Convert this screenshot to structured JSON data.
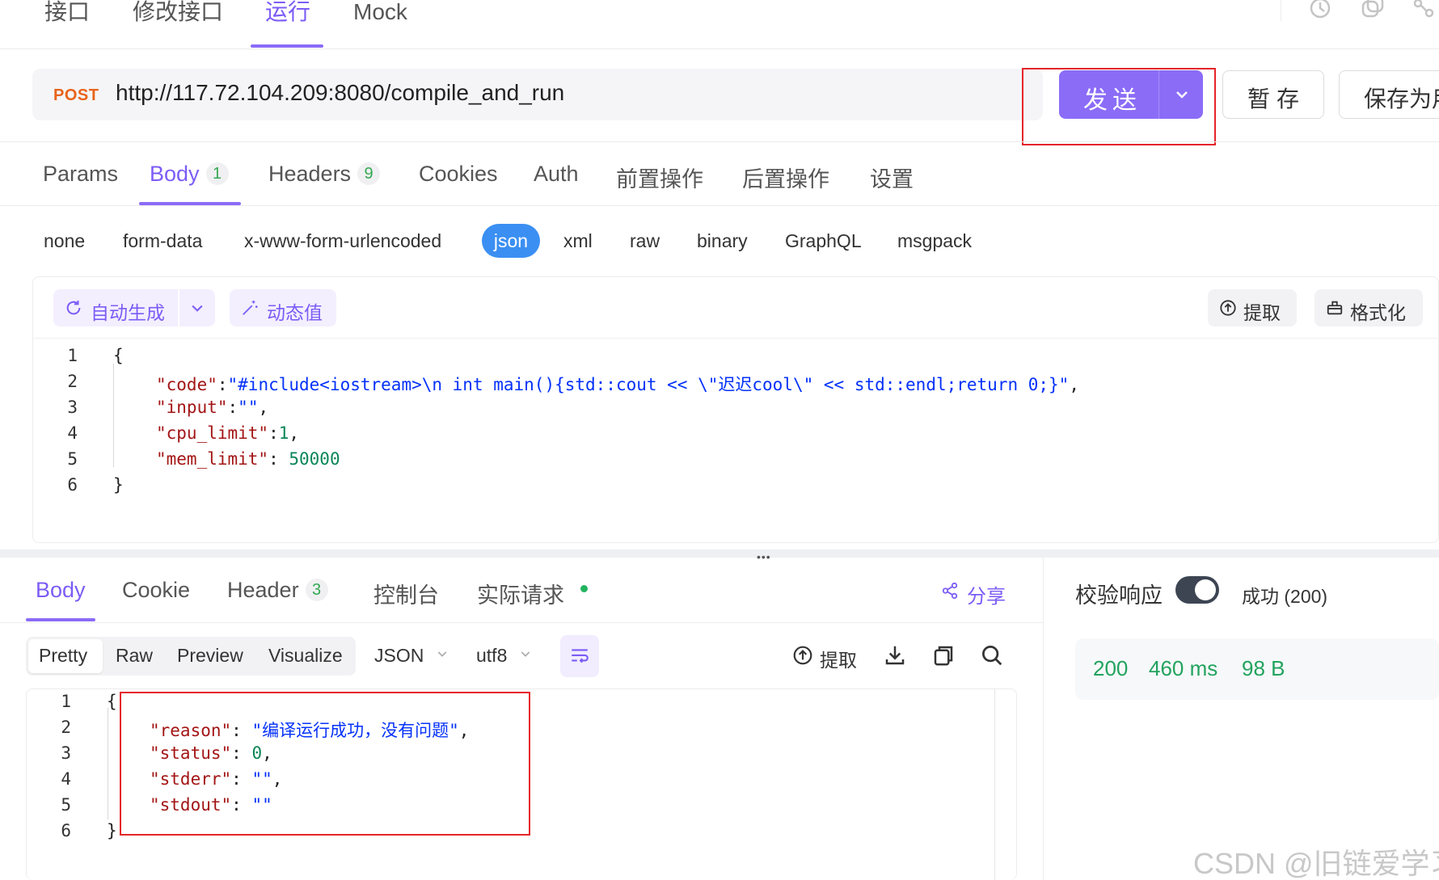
{
  "top_tabs": [
    {
      "label": "接口"
    },
    {
      "label": "修改接口"
    },
    {
      "label": "运行",
      "active": true
    },
    {
      "label": "Mock"
    }
  ],
  "request": {
    "method": "POST",
    "url": "http://117.72.104.209:8080/compile_and_run",
    "send_label": "发送",
    "save_temp_label": "暂存",
    "save_as_label": "保存为用例"
  },
  "request_tabs": [
    {
      "label": "Params"
    },
    {
      "label": "Body",
      "badge": "1",
      "active": true
    },
    {
      "label": "Headers",
      "badge": "9"
    },
    {
      "label": "Cookies"
    },
    {
      "label": "Auth"
    },
    {
      "label": "前置操作"
    },
    {
      "label": "后置操作"
    },
    {
      "label": "设置"
    }
  ],
  "body_types": [
    "none",
    "form-data",
    "x-www-form-urlencoded",
    "json",
    "xml",
    "raw",
    "binary",
    "GraphQL",
    "msgpack"
  ],
  "body_type_selected": "json",
  "editor_toolbar": {
    "auto_generate": "自动生成",
    "dynamic_value": "动态值",
    "extract": "提取",
    "format": "格式化"
  },
  "request_body_lines": [
    {
      "n": "1",
      "open": "{"
    },
    {
      "n": "2",
      "key": "\"code\"",
      "sep": ":",
      "value": "\"#include<iostream>\\n int main(){std::cout << \\\"迟迟cool\\\" << std::endl;return 0;}\"",
      "end": ","
    },
    {
      "n": "3",
      "key": "\"input\"",
      "sep": ":",
      "value": "\"\"",
      "end": ","
    },
    {
      "n": "4",
      "key": "\"cpu_limit\"",
      "sep": ":",
      "num": "1",
      "end": ","
    },
    {
      "n": "5",
      "key": "\"mem_limit\"",
      "sep": ": ",
      "num": "50000",
      "end": ""
    },
    {
      "n": "6",
      "close": "}"
    }
  ],
  "response_tabs": [
    {
      "label": "Body",
      "active": true
    },
    {
      "label": "Cookie"
    },
    {
      "label": "Header",
      "badge": "3"
    },
    {
      "label": "控制台"
    },
    {
      "label": "实际请求"
    }
  ],
  "share_label": "分享",
  "view_modes": [
    "Pretty",
    "Raw",
    "Preview",
    "Visualize"
  ],
  "format_select": "JSON",
  "encoding_select": "utf8",
  "response_extract_label": "提取",
  "response_body_lines": [
    {
      "n": "1",
      "open": "{"
    },
    {
      "n": "2",
      "key": "\"reason\"",
      "sep": ": ",
      "value": "\"编译运行成功，没有问题\"",
      "end": ","
    },
    {
      "n": "3",
      "key": "\"status\"",
      "sep": ": ",
      "num": "0",
      "end": ","
    },
    {
      "n": "4",
      "key": "\"stderr\"",
      "sep": ": ",
      "value": "\"\"",
      "end": ","
    },
    {
      "n": "5",
      "key": "\"stdout\"",
      "sep": ": ",
      "value": "\"\"",
      "end": ""
    },
    {
      "n": "6",
      "close": "}"
    }
  ],
  "verify": {
    "label": "校验响应",
    "enabled": true,
    "status_text": "成功 (200)"
  },
  "metrics": {
    "status": "200",
    "time": "460 ms",
    "size": "98 B"
  },
  "watermark": "CSDN @旧链爱学习",
  "colors": {
    "accent": "#8b6cf7",
    "method": "#e8631a",
    "success": "#22a35e",
    "highlight_box": "#e5252a",
    "json_chip": "#3b8ff2"
  }
}
